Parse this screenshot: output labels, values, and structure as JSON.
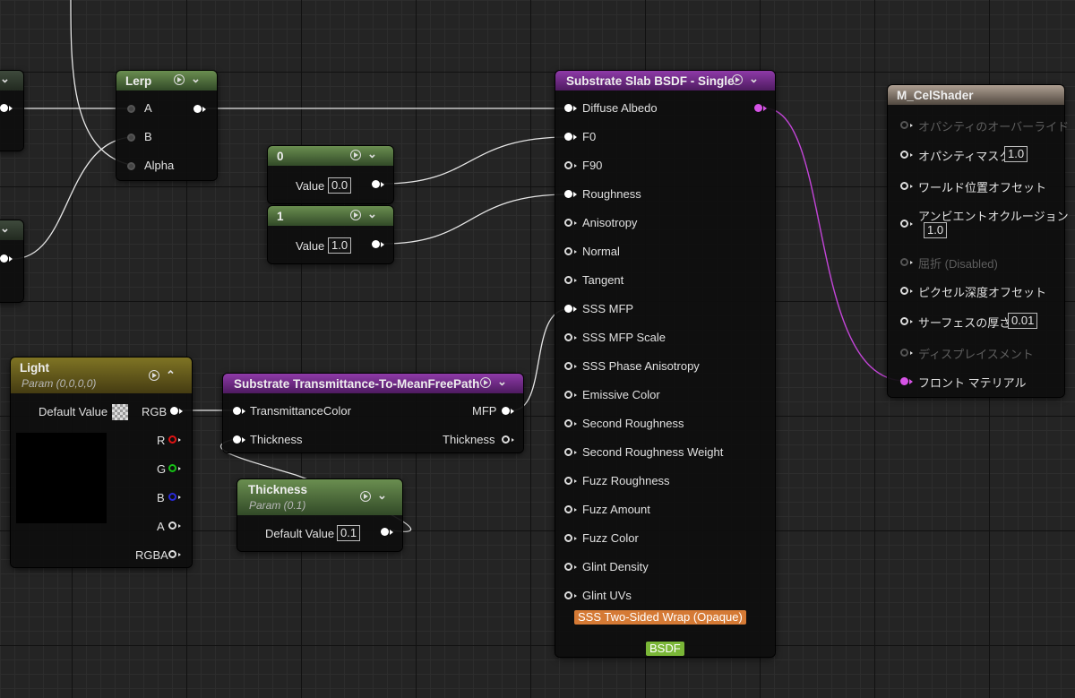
{
  "graph": {
    "lerp": {
      "title": "Lerp",
      "inputs": [
        "A",
        "B",
        "Alpha"
      ]
    },
    "const0": {
      "title": "0",
      "field_label": "Value",
      "value": "0.0"
    },
    "const1": {
      "title": "1",
      "field_label": "Value",
      "value": "1.0"
    },
    "light": {
      "title": "Light",
      "subtitle": "Param (0,0,0,0)",
      "default_label": "Default Value",
      "outputs": [
        "RGB",
        "R",
        "G",
        "B",
        "A",
        "RGBA"
      ]
    },
    "transmittance": {
      "title": "Substrate Transmittance-To-MeanFreePath",
      "inputs": [
        "TransmittanceColor",
        "Thickness"
      ],
      "outputs": [
        "MFP",
        "Thickness"
      ]
    },
    "thickness": {
      "title": "Thickness",
      "subtitle": "Param (0.1)",
      "default_label": "Default Value",
      "value": "0.1"
    },
    "slab": {
      "title": "Substrate Slab BSDF - Single",
      "inputs": [
        "Diffuse Albedo",
        "F0",
        "F90",
        "Roughness",
        "Anisotropy",
        "Normal",
        "Tangent",
        "SSS MFP",
        "SSS MFP Scale",
        "SSS Phase Anisotropy",
        "Emissive Color",
        "Second Roughness",
        "Second Roughness Weight",
        "Fuzz Roughness",
        "Fuzz Amount",
        "Fuzz Color",
        "Glint Density",
        "Glint UVs"
      ],
      "sss_badge": "SSS Two-Sided Wrap (Opaque)",
      "bsdf_badge": "BSDF"
    },
    "material": {
      "title": "M_CelShader",
      "opacity_override": "オパシティのオーバーライド",
      "opacity_mask": "オパシティマスク",
      "opacity_mask_value": "1.0",
      "world_offset": "ワールド位置オフセット",
      "ao": "アンビエントオクルージョン",
      "ao_value": "1.0",
      "refraction": "屈折 (Disabled)",
      "pixel_depth": "ピクセル深度オフセット",
      "thickness": "サーフェスの厚さ",
      "thickness_value": "0.01",
      "displacement": "ディスプレイスメント",
      "front_material": "フロント マテリアル"
    }
  },
  "colors": {
    "wire": "#e6e6e6",
    "material_wire": "#c345d8",
    "sss_badge": "#d57a35",
    "bsdf_badge": "#7ab637"
  }
}
